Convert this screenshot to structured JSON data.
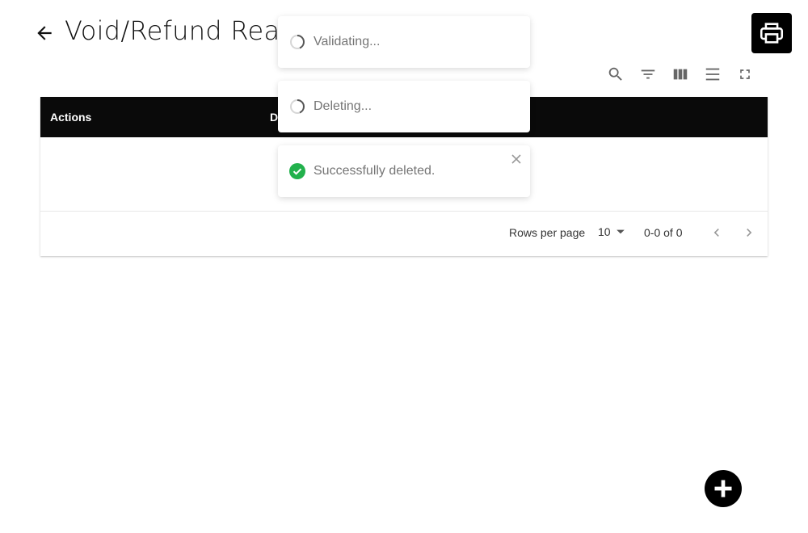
{
  "header": {
    "title": "Void/Refund Rea",
    "back_icon": "arrow-left-icon",
    "print_icon": "printer-icon"
  },
  "toolbar": {
    "icons": [
      "search-icon",
      "filter-icon",
      "view-columns-icon",
      "density-icon",
      "fullscreen-icon"
    ]
  },
  "table": {
    "columns": [
      "Actions",
      "D"
    ],
    "rows": []
  },
  "pagination": {
    "rows_per_page_label": "Rows per page",
    "rows_per_page_value": "10",
    "range_text": "0-0 of 0"
  },
  "toasts": [
    {
      "type": "loading",
      "message": "Validating..."
    },
    {
      "type": "loading",
      "message": "Deleting..."
    },
    {
      "type": "success",
      "message": "Successfully deleted."
    }
  ],
  "fab": {
    "icon": "plus-icon"
  },
  "colors": {
    "header_bg": "#0a0a0a",
    "success": "#22b14c",
    "fab_bg": "#000000"
  }
}
